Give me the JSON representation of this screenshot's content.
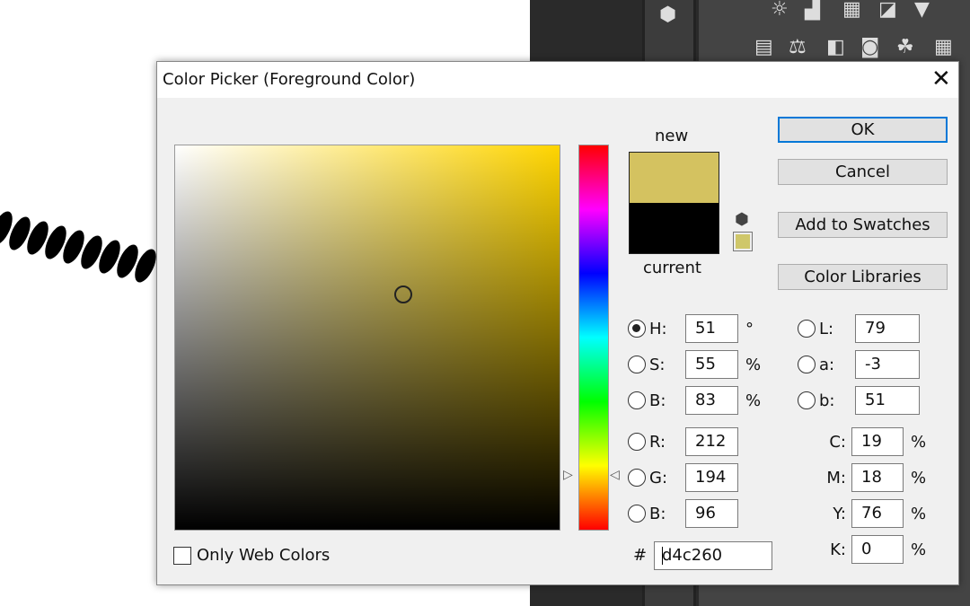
{
  "background_toolbar": {
    "icons": [
      "3d-cube-icon",
      "brightness-contrast-icon",
      "levels-icon",
      "curves-icon",
      "exposure-icon",
      "vibrance-icon",
      "gradient-map-icon",
      "color-balance-icon",
      "black-white-icon",
      "photo-filter-icon",
      "channel-mixer-icon",
      "color-lookup-icon"
    ]
  },
  "dialog": {
    "title": "Color Picker (Foreground Color)",
    "new_label": "new",
    "current_label": "current",
    "new_color": "#d4c260",
    "current_color": "#000000",
    "buttons": {
      "ok": "OK",
      "cancel": "Cancel",
      "add_to_swatches": "Add to Swatches",
      "color_libraries": "Color Libraries"
    },
    "hsb": [
      {
        "label": "H:",
        "value": "51",
        "unit": "°",
        "selected": true
      },
      {
        "label": "S:",
        "value": "55",
        "unit": "%",
        "selected": false
      },
      {
        "label": "B:",
        "value": "83",
        "unit": "%",
        "selected": false
      }
    ],
    "rgb": [
      {
        "label": "R:",
        "value": "212"
      },
      {
        "label": "G:",
        "value": "194"
      },
      {
        "label": "B:",
        "value": "96"
      }
    ],
    "lab": [
      {
        "label": "L:",
        "value": "79"
      },
      {
        "label": "a:",
        "value": "-3"
      },
      {
        "label": "b:",
        "value": "51"
      }
    ],
    "cmyk": [
      {
        "label": "C:",
        "value": "19",
        "unit": "%"
      },
      {
        "label": "M:",
        "value": "18",
        "unit": "%"
      },
      {
        "label": "Y:",
        "value": "76",
        "unit": "%"
      },
      {
        "label": "K:",
        "value": "0",
        "unit": "%"
      }
    ],
    "hex_label": "#",
    "hex_value": "d4c260",
    "only_web_colors": {
      "label": "Only Web Colors",
      "checked": false
    }
  }
}
